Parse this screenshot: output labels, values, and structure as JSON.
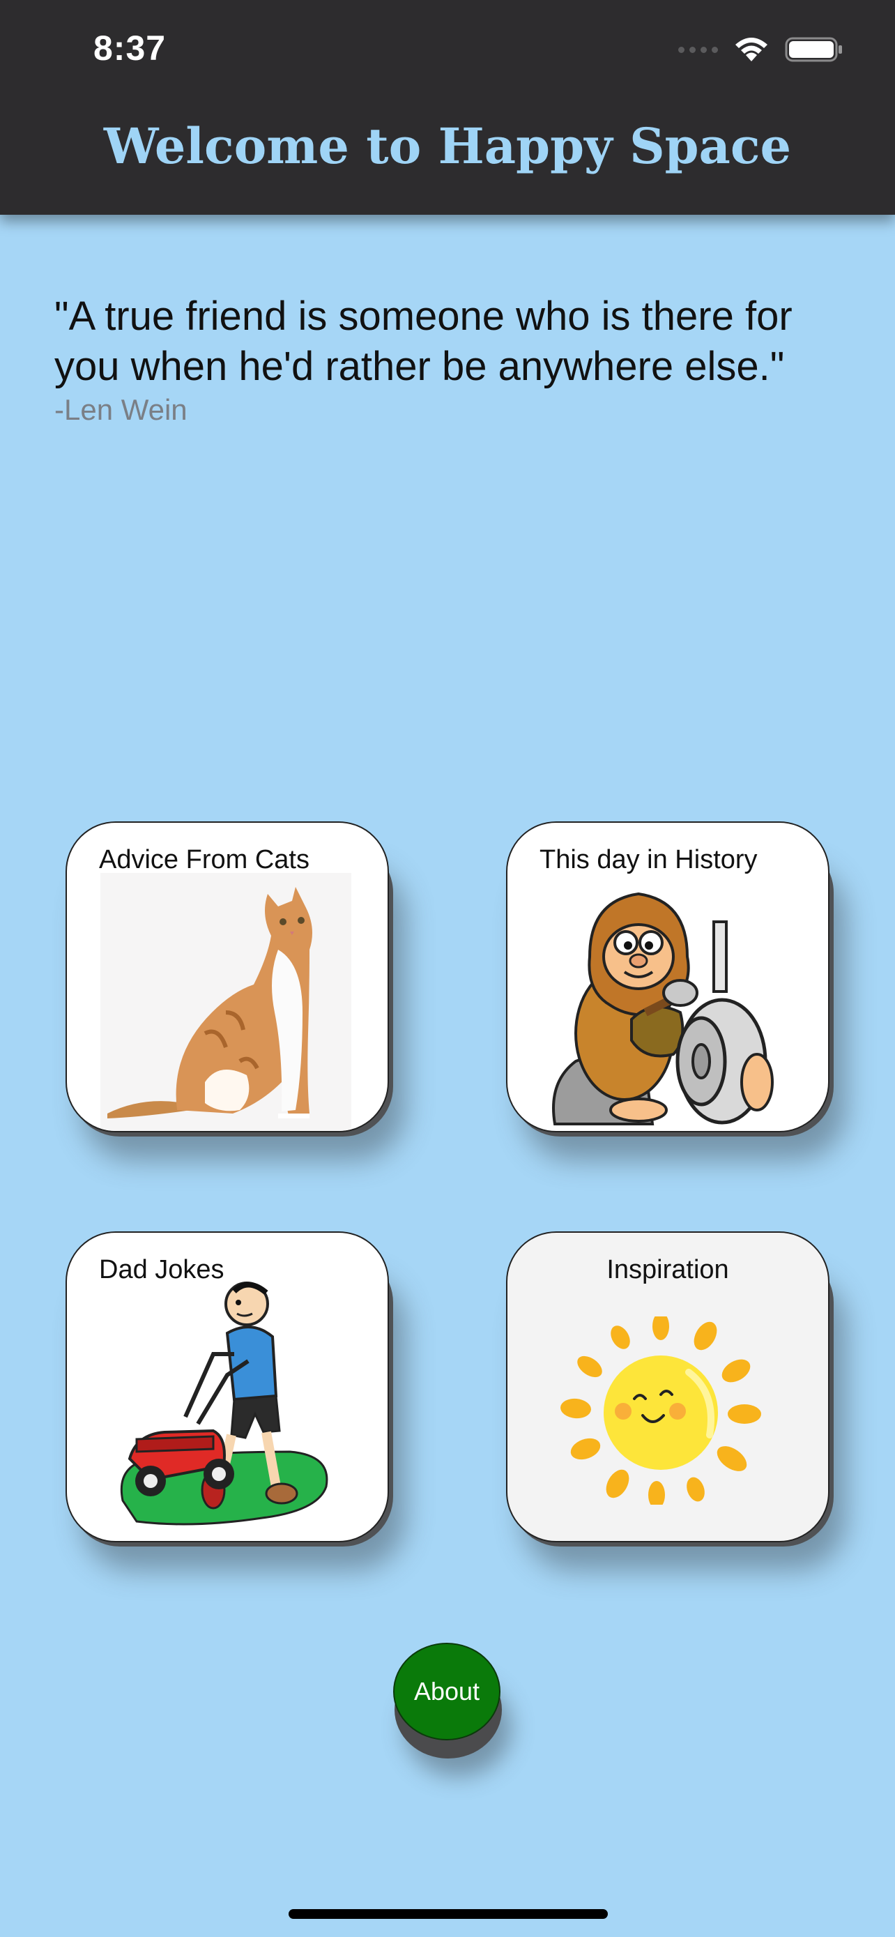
{
  "status_bar": {
    "time": "8:37"
  },
  "header": {
    "title": "Welcome to Happy Space"
  },
  "quote": {
    "text": "\"A true friend is someone who is there for you when he'd rather be anywhere else.\"",
    "author": "-Len Wein"
  },
  "tiles": [
    {
      "label": "Advice From Cats",
      "icon": "cat-image"
    },
    {
      "label": "This day in History",
      "icon": "caveman-image"
    },
    {
      "label": "Dad Jokes",
      "icon": "lawnmower-dad-image"
    },
    {
      "label": "Inspiration",
      "icon": "sun-image"
    }
  ],
  "about": {
    "label": "About"
  },
  "colors": {
    "background": "#a6d6f6",
    "header": "#2d2c2e",
    "title": "#9fd4f6",
    "about_button": "#0a7a0a"
  }
}
